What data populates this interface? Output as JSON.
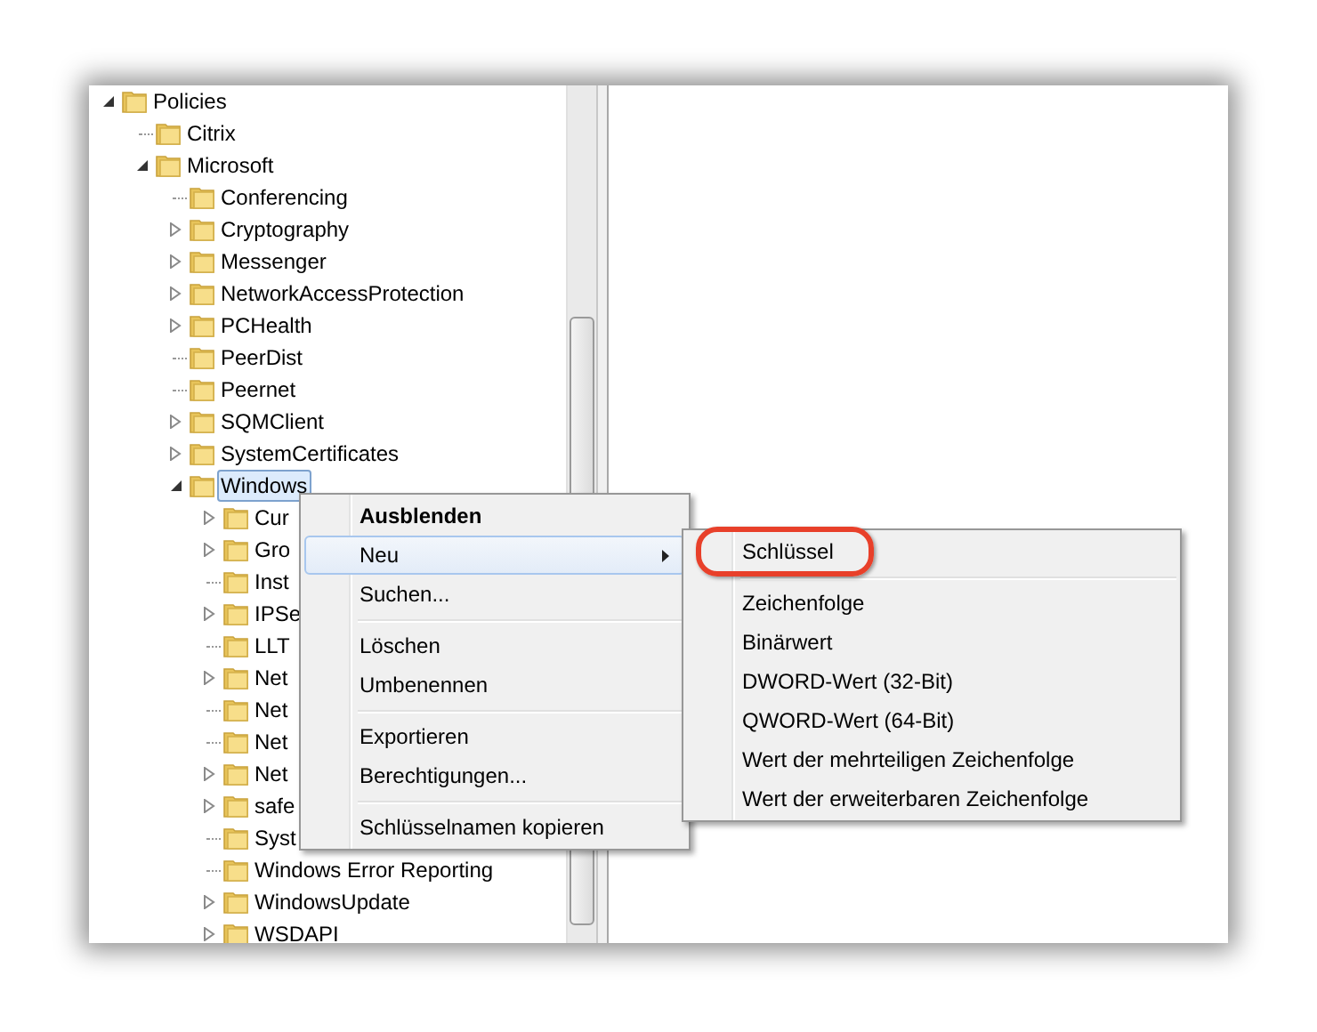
{
  "tree": [
    {
      "label": "Policies",
      "kind": "branch",
      "expanded": true,
      "selected": false,
      "children": [
        {
          "label": "Citrix",
          "kind": "leaf",
          "selected": false
        },
        {
          "label": "Microsoft",
          "kind": "branch",
          "expanded": true,
          "selected": false,
          "children": [
            {
              "label": "Conferencing",
              "kind": "leaf",
              "selected": false
            },
            {
              "label": "Cryptography",
              "kind": "branch",
              "expanded": false,
              "selected": false
            },
            {
              "label": "Messenger",
              "kind": "branch",
              "expanded": false,
              "selected": false
            },
            {
              "label": "NetworkAccessProtection",
              "kind": "branch",
              "expanded": false,
              "selected": false
            },
            {
              "label": "PCHealth",
              "kind": "branch",
              "expanded": false,
              "selected": false
            },
            {
              "label": "PeerDist",
              "kind": "leaf",
              "selected": false
            },
            {
              "label": "Peernet",
              "kind": "leaf",
              "selected": false
            },
            {
              "label": "SQMClient",
              "kind": "branch",
              "expanded": false,
              "selected": false
            },
            {
              "label": "SystemCertificates",
              "kind": "branch",
              "expanded": false,
              "selected": false
            },
            {
              "label": "Windows",
              "kind": "branch",
              "expanded": true,
              "selected": true,
              "children": [
                {
                  "label": "Cur",
                  "kind": "branch",
                  "expanded": false,
                  "selected": false
                },
                {
                  "label": "Gro",
                  "kind": "branch",
                  "expanded": false,
                  "selected": false
                },
                {
                  "label": "Inst",
                  "kind": "leaf",
                  "selected": false
                },
                {
                  "label": "IPSe",
                  "kind": "branch",
                  "expanded": false,
                  "selected": false
                },
                {
                  "label": "LLT",
                  "kind": "leaf",
                  "selected": false
                },
                {
                  "label": "Net",
                  "kind": "branch",
                  "expanded": false,
                  "selected": false
                },
                {
                  "label": "Net",
                  "kind": "leaf",
                  "selected": false
                },
                {
                  "label": "Net",
                  "kind": "leaf",
                  "selected": false
                },
                {
                  "label": "Net",
                  "kind": "branch",
                  "expanded": false,
                  "selected": false
                },
                {
                  "label": "safe",
                  "kind": "branch",
                  "expanded": false,
                  "selected": false
                },
                {
                  "label": "Syst",
                  "kind": "leaf",
                  "selected": false
                },
                {
                  "label": "Windows Error Reporting",
                  "kind": "leaf",
                  "selected": false
                },
                {
                  "label": "WindowsUpdate",
                  "kind": "branch",
                  "expanded": false,
                  "selected": false
                },
                {
                  "label": "WSDAPI",
                  "kind": "branch",
                  "expanded": false,
                  "selected": false
                }
              ]
            }
          ]
        }
      ]
    }
  ],
  "context_menu": {
    "groups": [
      [
        {
          "label": "Ausblenden",
          "kind": "default",
          "selected": false
        },
        {
          "label": "Neu",
          "kind": "submenu",
          "selected": true
        },
        {
          "label": "Suchen...",
          "kind": "item",
          "selected": false
        }
      ],
      [
        {
          "label": "Löschen",
          "kind": "item",
          "selected": false
        },
        {
          "label": "Umbenennen",
          "kind": "item",
          "selected": false
        }
      ],
      [
        {
          "label": "Exportieren",
          "kind": "item",
          "selected": false
        },
        {
          "label": "Berechtigungen...",
          "kind": "item",
          "selected": false
        }
      ],
      [
        {
          "label": "Schlüsselnamen kopieren",
          "kind": "item",
          "selected": false
        }
      ]
    ]
  },
  "submenu": {
    "groups": [
      [
        {
          "label": "Schlüssel",
          "circled": true
        }
      ],
      [
        {
          "label": "Zeichenfolge",
          "circled": false
        },
        {
          "label": "Binärwert",
          "circled": false
        },
        {
          "label": "DWORD-Wert (32-Bit)",
          "circled": false
        },
        {
          "label": "QWORD-Wert (64-Bit)",
          "circled": false
        },
        {
          "label": "Wert der mehrteiligen Zeichenfolge",
          "circled": false
        },
        {
          "label": "Wert der erweiterbaren Zeichenfolge",
          "circled": false
        }
      ]
    ]
  }
}
